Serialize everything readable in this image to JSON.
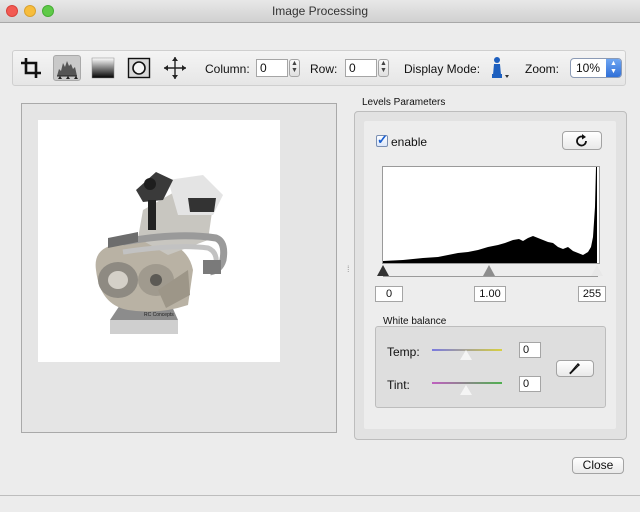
{
  "window": {
    "title": "Image Processing"
  },
  "toolbar": {
    "tools": [
      "crop-icon",
      "levels-icon",
      "gradient-icon",
      "vignette-icon",
      "move-icon"
    ],
    "column_label": "Column:",
    "column_value": "0",
    "row_label": "Row:",
    "row_value": "0",
    "display_mode_label": "Display Mode:",
    "zoom_label": "Zoom:",
    "zoom_value": "10%"
  },
  "preview": {
    "caption": "RC Concepts"
  },
  "levels": {
    "title": "Levels Parameters",
    "enable_label": "enable",
    "enable_checked": true,
    "black_point": "0",
    "gamma": "1.00",
    "white_point": "255"
  },
  "white_balance": {
    "title": "White balance",
    "temp_label": "Temp:",
    "temp_value": "0",
    "tint_label": "Tint:",
    "tint_value": "0"
  },
  "footer": {
    "close_label": "Close"
  }
}
